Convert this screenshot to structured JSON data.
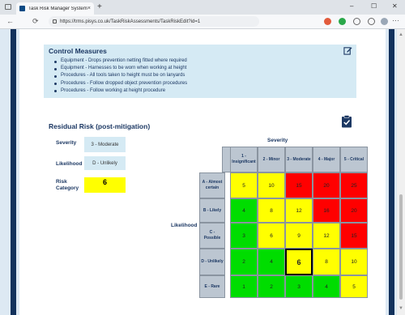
{
  "browser": {
    "tab_title": "Task Risk Manager System",
    "tab_close": "×",
    "new_tab": "+",
    "url": "https://trms.pisys.co.uk/TaskRiskAssessments/TaskRiskEdit?id=1",
    "window_controls": {
      "minimize": "–",
      "maximize": "☐",
      "close": "✕"
    },
    "nav": {
      "back": "←",
      "refresh": "⟳"
    },
    "menu": "···"
  },
  "control_measures": {
    "title": "Control Measures",
    "items": [
      "Equipment - Drops prevention netting fitted where required",
      "Equipment - Harnesses to be worn when working at height",
      "Procedures - All tools taken to height must be on lanyards",
      "Procedures - Follow dropped object prevention procedures",
      "Procedures - Follow working at height procedure"
    ]
  },
  "residual_risk": {
    "title": "Residual Risk (post-mitigation)",
    "severity_label": "Severity",
    "severity_value": "3 - Moderate",
    "likelihood_label": "Likelihood",
    "likelihood_value": "D - Unlikely",
    "risk_category_label": "Risk Category",
    "risk_category_value": "6",
    "risk_category_color": "#ffff00"
  },
  "matrix": {
    "severity_title": "Severity",
    "likelihood_title": "Likelihood",
    "severity_headers": [
      "1 - Insignificant",
      "2 - Minor",
      "3 - Moderate",
      "4 - Major",
      "5 - Critical"
    ],
    "likelihood_headers": [
      "A - Almost certain",
      "B - Likely",
      "C - Possible",
      "D - Unlikely",
      "E - Rare"
    ],
    "values": [
      [
        "5",
        "10",
        "15",
        "20",
        "25"
      ],
      [
        "4",
        "8",
        "12",
        "16",
        "20"
      ],
      [
        "3",
        "6",
        "9",
        "12",
        "15"
      ],
      [
        "2",
        "4",
        "6",
        "8",
        "10"
      ],
      [
        "1",
        "2",
        "3",
        "4",
        "5"
      ]
    ],
    "colors": [
      [
        "#ffff00",
        "#ffff00",
        "#ff0000",
        "#ff0000",
        "#ff0000"
      ],
      [
        "#00dd00",
        "#ffff00",
        "#ffff00",
        "#ff0000",
        "#ff0000"
      ],
      [
        "#00dd00",
        "#ffff00",
        "#ffff00",
        "#ffff00",
        "#ff0000"
      ],
      [
        "#00dd00",
        "#00dd00",
        "#ffff00",
        "#ffff00",
        "#ffff00"
      ],
      [
        "#00dd00",
        "#00dd00",
        "#00dd00",
        "#00dd00",
        "#ffff00"
      ]
    ],
    "selected_row": 3,
    "selected_col": 2
  },
  "colors": {
    "navy": "#13325c",
    "panel": "#d5eaf4",
    "header_gray": "#bcc6d1"
  }
}
